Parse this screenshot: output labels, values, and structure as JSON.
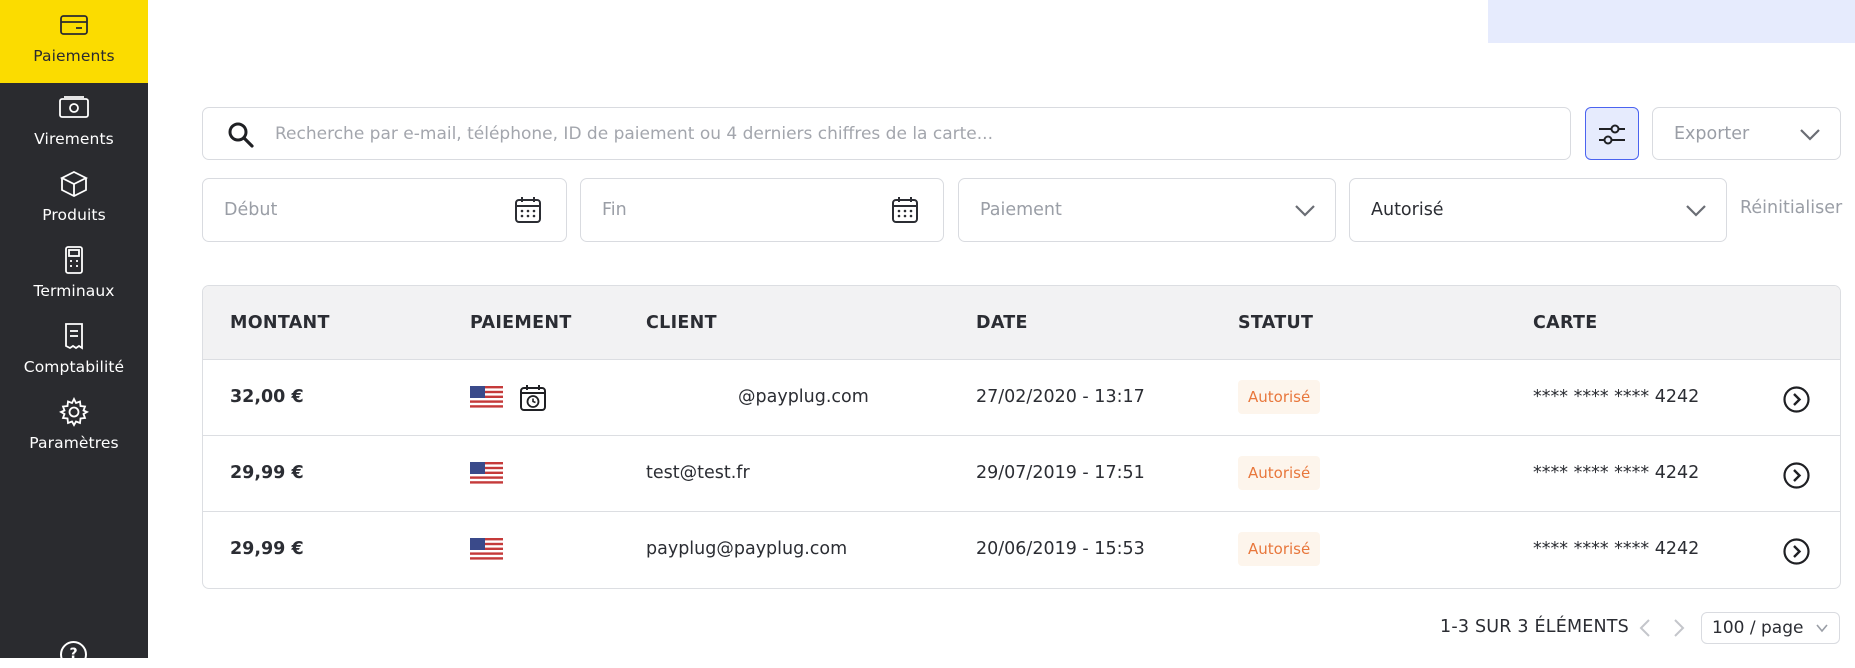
{
  "sidebar": {
    "items": [
      {
        "label": "Paiements",
        "icon": "card-icon",
        "active": true
      },
      {
        "label": "Virements",
        "icon": "banknote-icon"
      },
      {
        "label": "Produits",
        "icon": "box-icon"
      },
      {
        "label": "Terminaux",
        "icon": "terminal-icon"
      },
      {
        "label": "Comptabilité",
        "icon": "receipt-icon"
      },
      {
        "label": "Paramètres",
        "icon": "gear-icon"
      }
    ],
    "help_icon": "?"
  },
  "search": {
    "placeholder": "Recherche par e-mail, téléphone, ID de paiement ou 4 derniers chiffres de la carte...",
    "value": ""
  },
  "toolbar": {
    "export_label": "Exporter"
  },
  "filters": {
    "start_placeholder": "Début",
    "end_placeholder": "Fin",
    "payment_placeholder": "Paiement",
    "status_value": "Autorisé",
    "reset_label": "Réinitialiser"
  },
  "table": {
    "headers": [
      "MONTANT",
      "PAIEMENT",
      "CLIENT",
      "DATE",
      "STATUT",
      "CARTE"
    ],
    "rows": [
      {
        "amount": "32,00 €",
        "client": "@payplug.com",
        "date": "27/02/2020 - 13:17",
        "status": "Autorisé",
        "card": "**** **** **** 4242",
        "scheduled": true
      },
      {
        "amount": "29,99 €",
        "client": "test@test.fr",
        "date": "29/07/2019 - 17:51",
        "status": "Autorisé",
        "card": "**** **** **** 4242",
        "scheduled": false
      },
      {
        "amount": "29,99 €",
        "client": "payplug@payplug.com",
        "date": "20/06/2019 - 15:53",
        "status": "Autorisé",
        "card": "**** **** **** 4242",
        "scheduled": false
      }
    ]
  },
  "pagination": {
    "summary": "1-3 SUR 3 ÉLÉMENTS",
    "page_size": "100 / page"
  },
  "colors": {
    "sidebar_bg": "#2a2b2f",
    "active_nav": "#fbdc00",
    "accent_blue": "#4b63f0",
    "status_orange": "#e8773c"
  }
}
